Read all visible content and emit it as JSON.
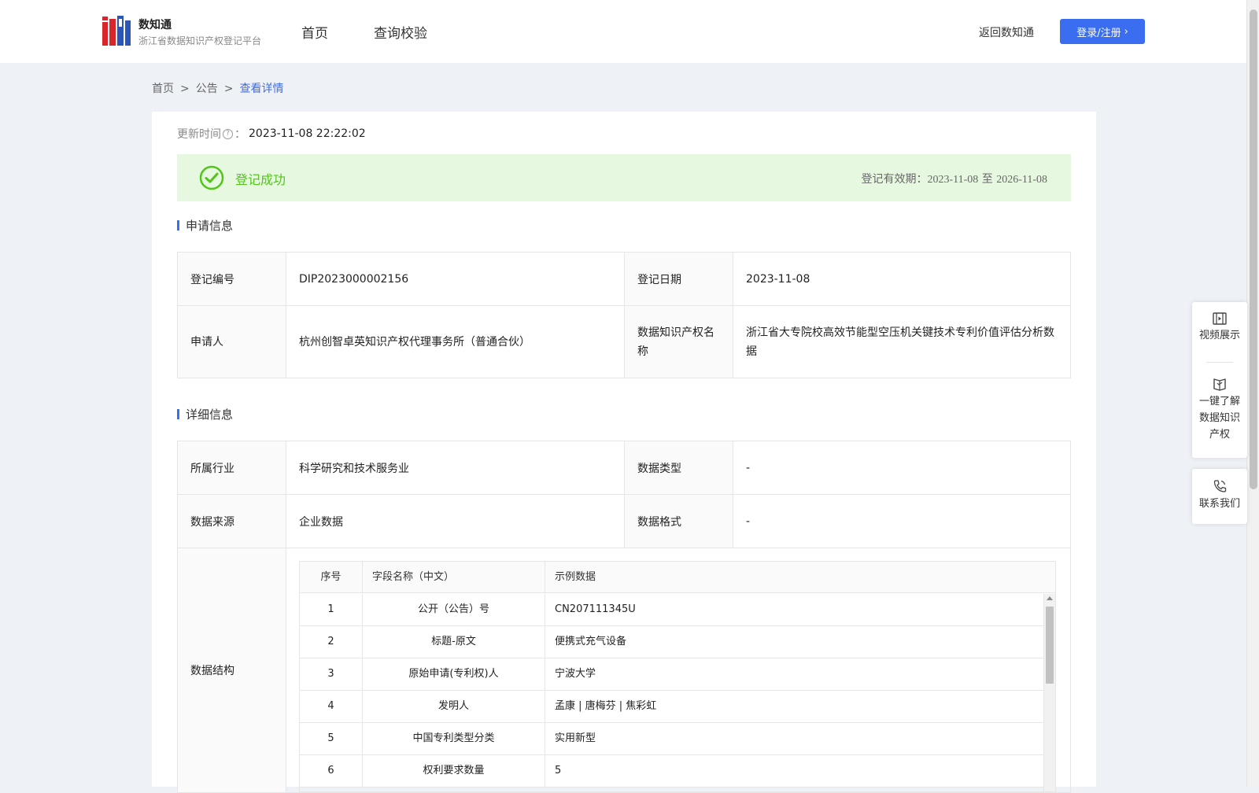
{
  "header": {
    "brand_name": "数知通",
    "brand_sub": "浙江省数据知识产权登记平台",
    "nav": [
      "首页",
      "查询校验"
    ],
    "return_link": "返回数知通",
    "login_label": "登录/注册",
    "accent_color": "#3a6df0"
  },
  "breadcrumb": [
    "首页",
    "公告",
    "查看详情"
  ],
  "update": {
    "label": "更新时间",
    "value": "2023-11-08 22:22:02"
  },
  "status": {
    "text": "登记成功",
    "validity_label": "登记有效期：",
    "validity_from": "2023-11-08",
    "validity_sep": "至",
    "validity_to": "2026-11-08",
    "color": "#52c41a"
  },
  "apply_section": {
    "title": "申请信息",
    "reg_no_label": "登记编号",
    "reg_no": "DIP2023000002156",
    "reg_date_label": "登记日期",
    "reg_date": "2023-11-08",
    "applicant_label": "申请人",
    "applicant": "杭州创智卓英知识产权代理事务所（普通合伙）",
    "ip_name_label": "数据知识产权名称",
    "ip_name": "浙江省大专院校高效节能型空压机关键技术专利价值评估分析数据"
  },
  "detail_section": {
    "title": "详细信息",
    "industry_label": "所属行业",
    "industry": "科学研究和技术服务业",
    "data_type_label": "数据类型",
    "data_type": "-",
    "source_label": "数据来源",
    "source": "企业数据",
    "format_label": "数据格式",
    "format": "-",
    "structure_label": "数据结构",
    "structure_headers": [
      "序号",
      "字段名称（中文）",
      "示例数据"
    ],
    "structure_rows": [
      {
        "no": "1",
        "field": "公开（公告）号",
        "sample": "CN207111345U"
      },
      {
        "no": "2",
        "field": "标题-原文",
        "sample": "便携式充气设备"
      },
      {
        "no": "3",
        "field": "原始申请(专利权)人",
        "sample": "宁波大学"
      },
      {
        "no": "4",
        "field": "发明人",
        "sample": "孟康 | 唐梅芬 | 焦彩虹"
      },
      {
        "no": "5",
        "field": "中国专利类型分类",
        "sample": "实用新型"
      },
      {
        "no": "6",
        "field": "权利要求数量",
        "sample": "5"
      }
    ]
  },
  "float_panel": {
    "video": "视频展示",
    "learn": [
      "一键了解",
      "数据知识",
      "产权"
    ],
    "contact": "联系我们"
  }
}
